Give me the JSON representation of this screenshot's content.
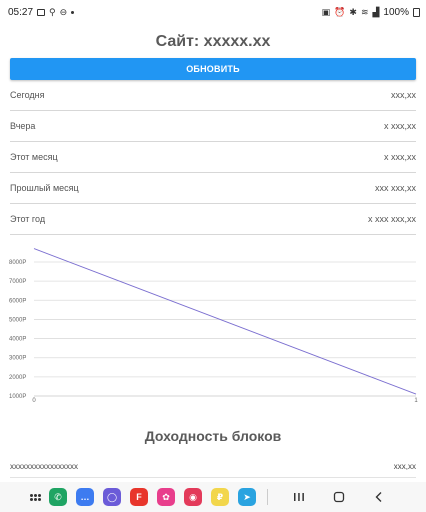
{
  "status_bar": {
    "time": "05:27",
    "battery": "100%"
  },
  "page_title": "Сайт: xxxxx.xx",
  "refresh_label": "Обновить",
  "stats": [
    {
      "label": "Сегодня",
      "value": "xxx,xx"
    },
    {
      "label": "Вчера",
      "value": "x xxx,xx"
    },
    {
      "label": "Этот месяц",
      "value": "x xxx,xx"
    },
    {
      "label": "Прошлый месяц",
      "value": "xxx xxx,xx"
    },
    {
      "label": "Этот год",
      "value": "x xxx xxx,xx"
    }
  ],
  "chart_data": {
    "type": "line",
    "series": [
      {
        "x": [
          0,
          1
        ],
        "y": [
          8700,
          1100
        ]
      }
    ],
    "x_ticks": [
      "0",
      "1"
    ],
    "y_ticks": [
      "1000Р",
      "2000Р",
      "3000Р",
      "4000Р",
      "5000Р",
      "6000Р",
      "7000Р",
      "8000Р"
    ],
    "xlim": [
      0,
      1
    ],
    "ylim": [
      1000,
      8000
    ],
    "grid": true,
    "line_color": "#7b6fd0"
  },
  "blocks_title": "Доходность блоков",
  "block_rows": [
    {
      "label": "xxxxxxxxxxxxxxxxx",
      "value": "xxx,xx"
    }
  ],
  "nav_apps": [
    {
      "name": "phone-app-icon",
      "color": "#1fa463",
      "glyph": "✆"
    },
    {
      "name": "messages-app-icon",
      "color": "#3d7bf0",
      "glyph": "…"
    },
    {
      "name": "internet-app-icon",
      "color": "#6b5bd8",
      "glyph": "◯"
    },
    {
      "name": "flipboard-app-icon",
      "color": "#e8352b",
      "glyph": "F"
    },
    {
      "name": "blossom-app-icon",
      "color": "#e83e8c",
      "glyph": "✿"
    },
    {
      "name": "camera-app-icon",
      "color": "#e33a5a",
      "glyph": "◉"
    },
    {
      "name": "finance-app-icon",
      "color": "#f2d64b",
      "glyph": "₽"
    },
    {
      "name": "telegram-app-icon",
      "color": "#2aa3e0",
      "glyph": "➤"
    }
  ]
}
